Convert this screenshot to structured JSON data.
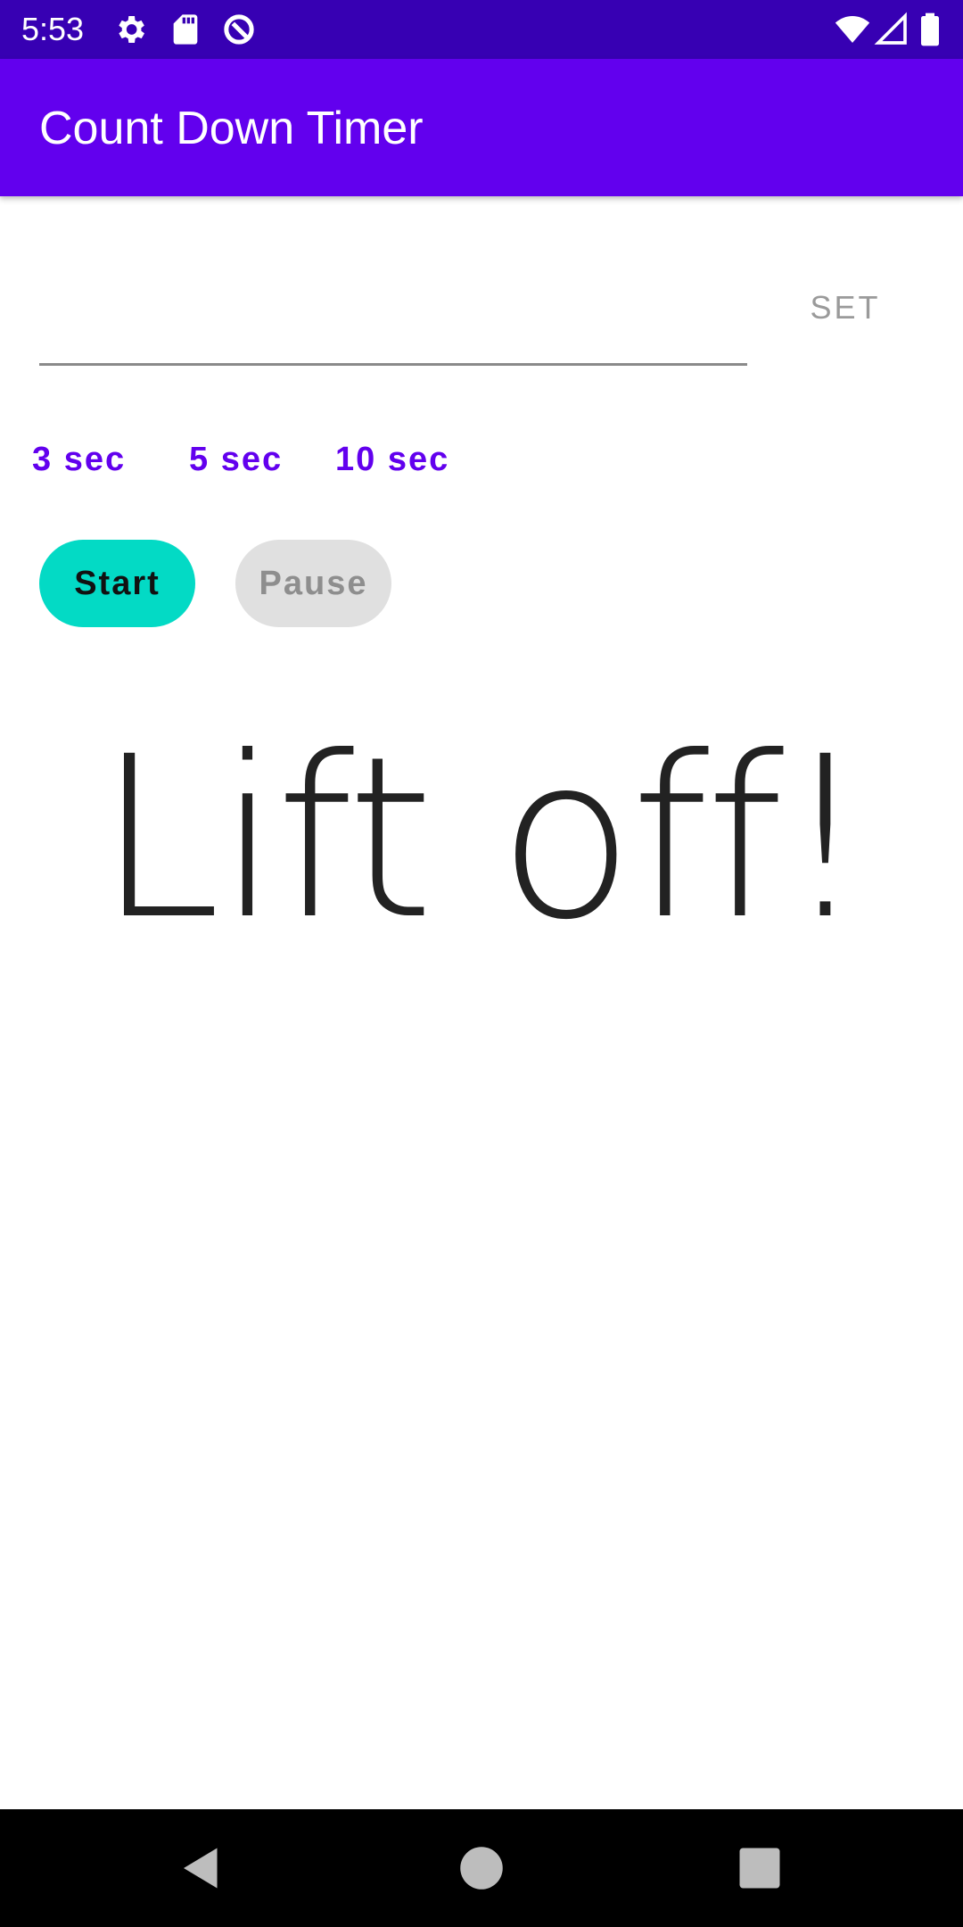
{
  "status_bar": {
    "time": "5:53",
    "icons_left": [
      "gear-icon",
      "sd-card-icon",
      "data-saver-icon"
    ],
    "icons_right": [
      "wifi-icon",
      "cell-signal-icon",
      "battery-icon"
    ],
    "background": "#3700b3"
  },
  "app_bar": {
    "title": "Count Down Timer",
    "background": "#6200ee"
  },
  "timer_input": {
    "value": "",
    "placeholder": ""
  },
  "set_button": {
    "label": "SET"
  },
  "presets": [
    {
      "label": "3 sec"
    },
    {
      "label": "5 sec"
    },
    {
      "label": "10 sec"
    }
  ],
  "controls": {
    "start_label": "Start",
    "pause_label": "Pause",
    "start_color": "#03dac5",
    "pause_color": "#e0e0e0"
  },
  "display": {
    "text": "Lift off!"
  },
  "nav_bar": {
    "icons": [
      "back-icon",
      "home-icon",
      "recents-icon"
    ]
  }
}
